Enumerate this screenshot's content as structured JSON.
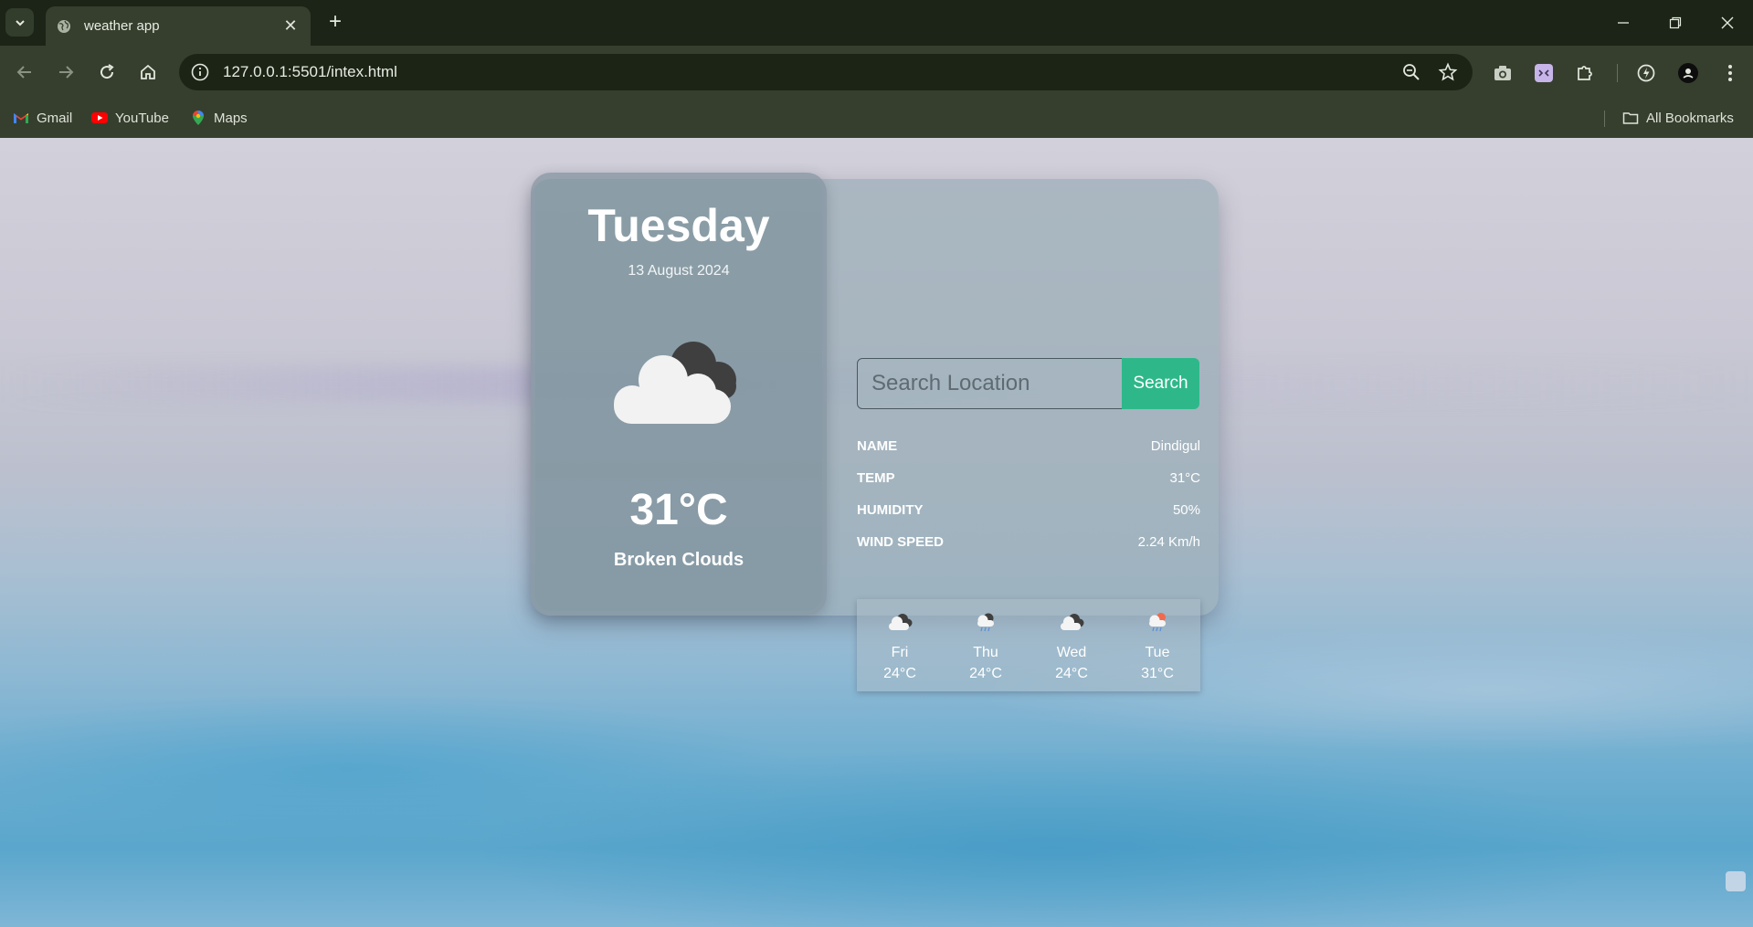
{
  "browser": {
    "tab_title": "weather app",
    "url": "127.0.0.1:5501/intex.html",
    "bookmarks": [
      {
        "label": "Gmail",
        "icon": "gmail-icon"
      },
      {
        "label": "YouTube",
        "icon": "youtube-icon"
      },
      {
        "label": "Maps",
        "icon": "maps-icon"
      }
    ],
    "all_bookmarks": "All Bookmarks"
  },
  "weather": {
    "day": "Tuesday",
    "date": "13 August 2024",
    "temp": "31°C",
    "description": "Broken Clouds",
    "search_placeholder": "Search Location",
    "search_button": "Search",
    "details": [
      {
        "key": "NAME",
        "value": "Dindigul"
      },
      {
        "key": "TEMP",
        "value": "31°C"
      },
      {
        "key": "HUMIDITY",
        "value": "50%"
      },
      {
        "key": "WIND SPEED",
        "value": "2.24 Km/h"
      }
    ],
    "forecast": [
      {
        "day": "Fri",
        "temp": "24°C",
        "icon": "broken-clouds-icon"
      },
      {
        "day": "Thu",
        "temp": "24°C",
        "icon": "rain-cloud-icon"
      },
      {
        "day": "Wed",
        "temp": "24°C",
        "icon": "broken-clouds-icon"
      },
      {
        "day": "Tue",
        "temp": "31°C",
        "icon": "rain-sun-icon"
      }
    ]
  },
  "colors": {
    "search_button": "#2eb88a",
    "browser_frame": "#363f2e"
  }
}
